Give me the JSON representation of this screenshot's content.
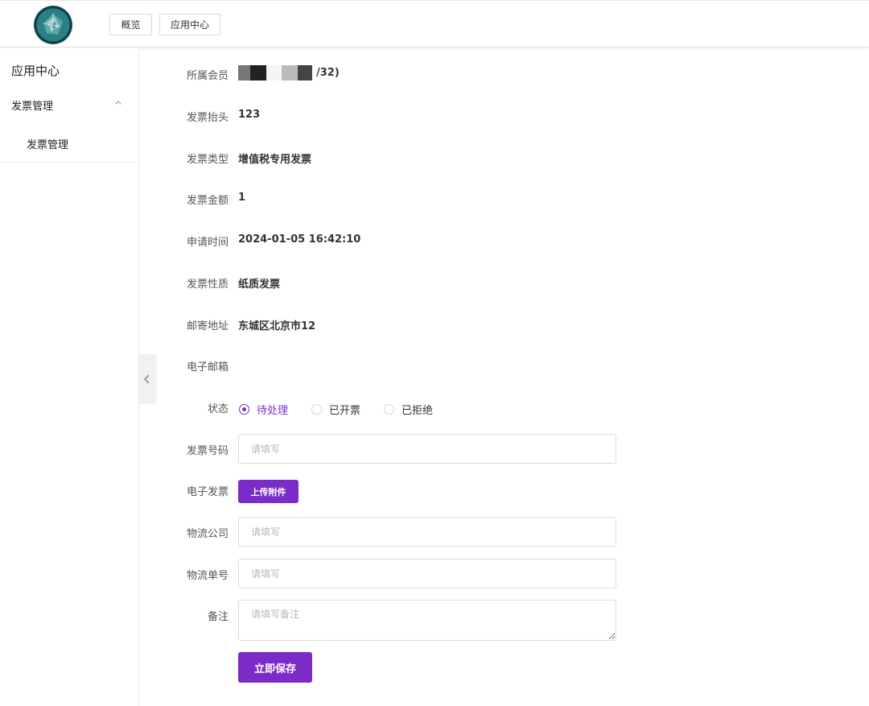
{
  "header": {
    "logo_icon": "globe-logo",
    "nav": [
      {
        "label": "概览"
      },
      {
        "label": "应用中心"
      }
    ]
  },
  "sidebar": {
    "title": "应用中心",
    "group": {
      "label": "发票管理",
      "icon": "chevron-up-icon",
      "expanded": true
    },
    "items": [
      {
        "label": "发票管理"
      }
    ]
  },
  "form": {
    "member": {
      "label": "所属会员",
      "value_visible_suffix": "/32)",
      "redacted": true
    },
    "title": {
      "label": "发票抬头",
      "value": "123"
    },
    "type": {
      "label": "发票类型",
      "value": "增值税专用发票"
    },
    "amount": {
      "label": "发票金额",
      "value": "1"
    },
    "apply_time": {
      "label": "申请时间",
      "value": "2024-01-05 16:42:10"
    },
    "nature": {
      "label": "发票性质",
      "value": "纸质发票"
    },
    "address": {
      "label": "邮寄地址",
      "value": "东城区北京市12"
    },
    "email": {
      "label": "电子邮箱",
      "value": ""
    },
    "status": {
      "label": "状态",
      "options": [
        {
          "label": "待处理",
          "selected": true
        },
        {
          "label": "已开票",
          "selected": false
        },
        {
          "label": "已拒绝",
          "selected": false
        }
      ]
    },
    "invoice_no": {
      "label": "发票号码",
      "value": "",
      "placeholder": "请填写"
    },
    "e_invoice": {
      "label": "电子发票",
      "button": "上传附件"
    },
    "logistics_company": {
      "label": "物流公司",
      "value": "",
      "placeholder": "请填写"
    },
    "tracking_no": {
      "label": "物流单号",
      "value": "",
      "placeholder": "请填写"
    },
    "remark": {
      "label": "备注",
      "value": "",
      "placeholder": "请填写备注"
    },
    "save_button": "立即保存"
  },
  "colors": {
    "primary": "#7b2cc8",
    "radio_active": "#7b2fcf",
    "border": "#dcdcdc",
    "placeholder": "#b7b7b7"
  }
}
